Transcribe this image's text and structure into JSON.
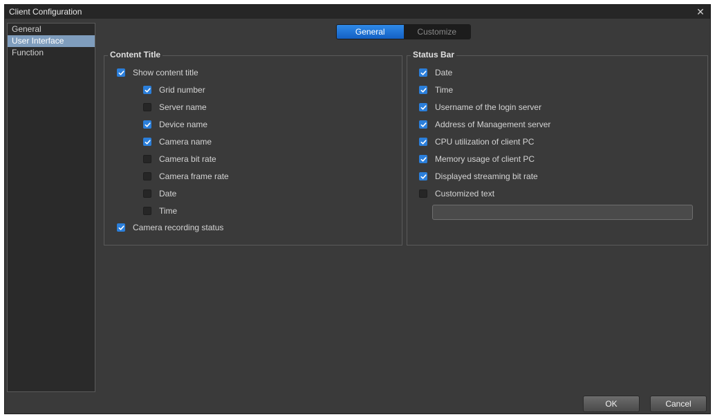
{
  "window": {
    "title": "Client Configuration",
    "close_glyph": "✕"
  },
  "sidebar": {
    "items": [
      {
        "label": "General",
        "active": false
      },
      {
        "label": "User Interface",
        "active": true
      },
      {
        "label": "Function",
        "active": false
      }
    ]
  },
  "tabs": {
    "general": "General",
    "customize": "Customize",
    "active": "General"
  },
  "content_title": {
    "title": "Content Title",
    "show_title": {
      "label": "Show content title",
      "checked": true
    },
    "items": [
      {
        "label": "Grid number",
        "checked": true
      },
      {
        "label": "Server name",
        "checked": false
      },
      {
        "label": "Device name",
        "checked": true
      },
      {
        "label": "Camera name",
        "checked": true
      },
      {
        "label": "Camera bit rate",
        "checked": false
      },
      {
        "label": "Camera frame rate",
        "checked": false
      },
      {
        "label": "Date",
        "checked": false
      },
      {
        "label": "Time",
        "checked": false
      }
    ],
    "recording": {
      "label": "Camera recording status",
      "checked": true
    }
  },
  "status_bar": {
    "title": "Status Bar",
    "items": [
      {
        "label": "Date",
        "checked": true
      },
      {
        "label": "Time",
        "checked": true
      },
      {
        "label": "Username of the login server",
        "checked": true
      },
      {
        "label": "Address of Management server",
        "checked": true
      },
      {
        "label": "CPU utilization of client PC",
        "checked": true
      },
      {
        "label": "Memory usage of client PC",
        "checked": true
      },
      {
        "label": "Displayed streaming bit rate",
        "checked": true
      },
      {
        "label": "Customized text",
        "checked": false
      }
    ],
    "custom_text_value": ""
  },
  "buttons": {
    "ok": "OK",
    "cancel": "Cancel"
  },
  "colors": {
    "accent": "#2b7fdb",
    "sidebar_active": "#7f9dbd",
    "background": "#3a3a3a"
  },
  "icons": {
    "check": "checkmark-icon",
    "close": "close-icon"
  }
}
